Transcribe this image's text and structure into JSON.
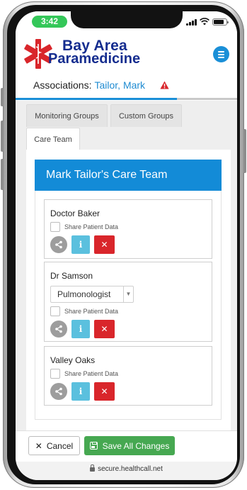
{
  "status_bar": {
    "time": "3:42",
    "icons": [
      "signal-icon",
      "wifi-icon",
      "battery-icon"
    ]
  },
  "header": {
    "logo_line1": "Bay Area",
    "logo_line2": "Paramedicine",
    "logo_icon": "star-of-life-icon",
    "menu_icon": "hamburger-menu-icon",
    "brand_color": "#152d8f",
    "accent_color": "#1a8fd7"
  },
  "associations": {
    "label": "Associations:",
    "name": "Tailor, Mark",
    "alert_icon": "warning-icon",
    "alert_color": "#d9262b"
  },
  "tabs": [
    {
      "label": "Monitoring Groups",
      "active": false
    },
    {
      "label": "Custom Groups",
      "active": false
    },
    {
      "label": "Care Team",
      "active": true
    }
  ],
  "care_team": {
    "title": "Mark Tailor's Care Team",
    "share_label": "Share Patient Data",
    "members": [
      {
        "name": "Doctor Baker",
        "role": null,
        "share_checked": false
      },
      {
        "name": "Dr Samson",
        "role": "Pulmonologist",
        "share_checked": false
      },
      {
        "name": "Valley Oaks",
        "role": null,
        "share_checked": false
      }
    ],
    "action_icons": {
      "share": "share-icon",
      "info": "info-icon",
      "delete": "close-icon"
    },
    "info_glyph": "i",
    "delete_glyph": "✕"
  },
  "footer": {
    "cancel_label": "Cancel",
    "save_label": "Save All Changes",
    "save_color": "#46a851"
  },
  "browser": {
    "url": "secure.healthcall.net"
  }
}
